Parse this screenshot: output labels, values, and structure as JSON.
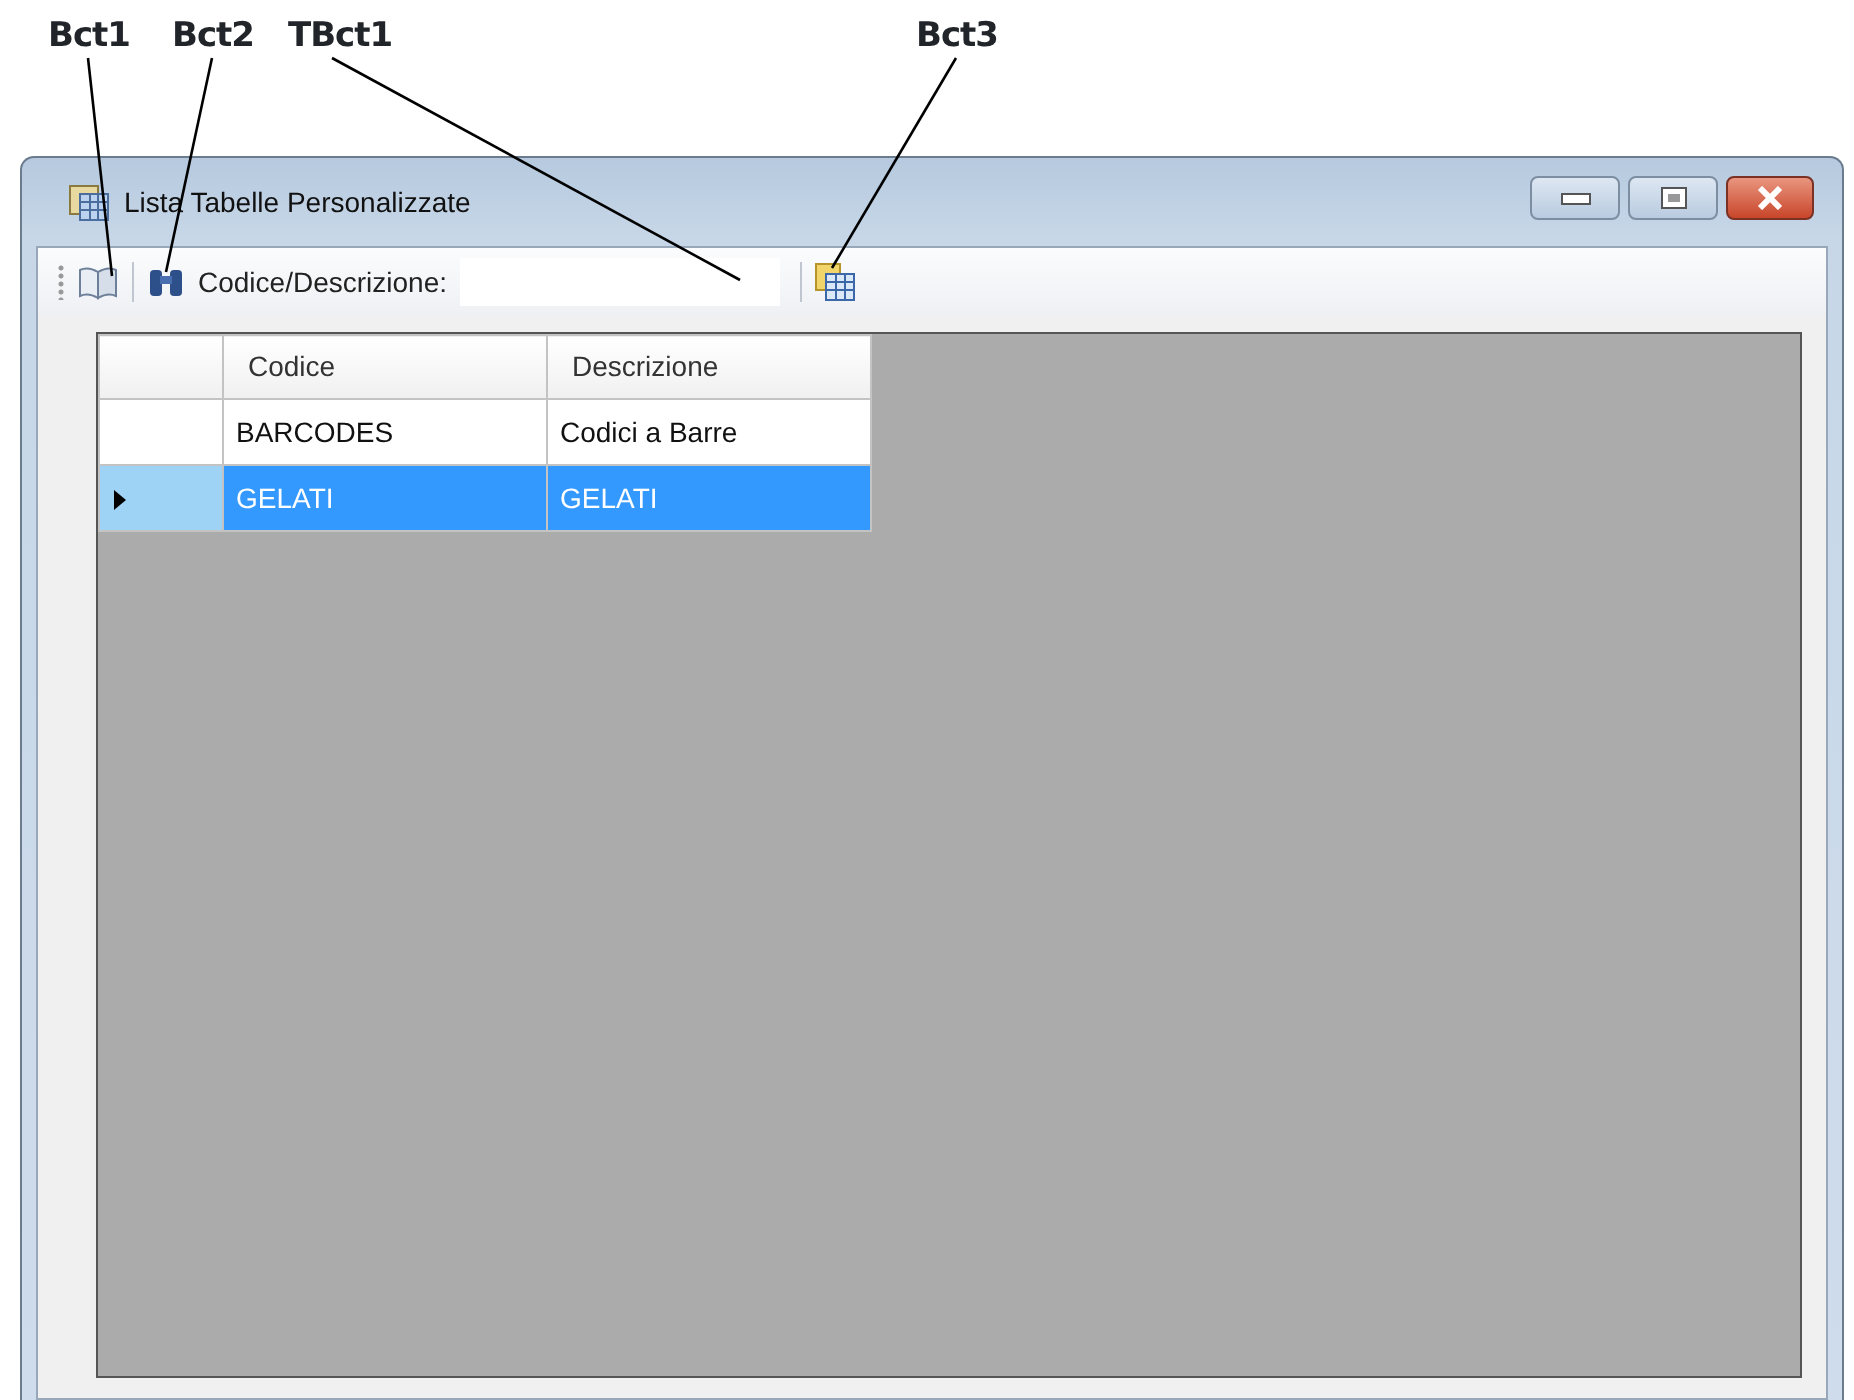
{
  "callouts": [
    {
      "label": "Bct1"
    },
    {
      "label": "Bct2"
    },
    {
      "label": "TBct1"
    },
    {
      "label": "Bct3"
    }
  ],
  "window": {
    "title": "Lista Tabelle Personalizzate"
  },
  "toolbar": {
    "field_label": "Codice/Descrizione:"
  },
  "table": {
    "columns": [
      "Codice",
      "Descrizione"
    ],
    "rows": [
      {
        "cells": [
          "BARCODES",
          "Codici a Barre"
        ],
        "selected": false
      },
      {
        "cells": [
          "GELATI",
          "GELATI"
        ],
        "selected": true
      }
    ]
  }
}
